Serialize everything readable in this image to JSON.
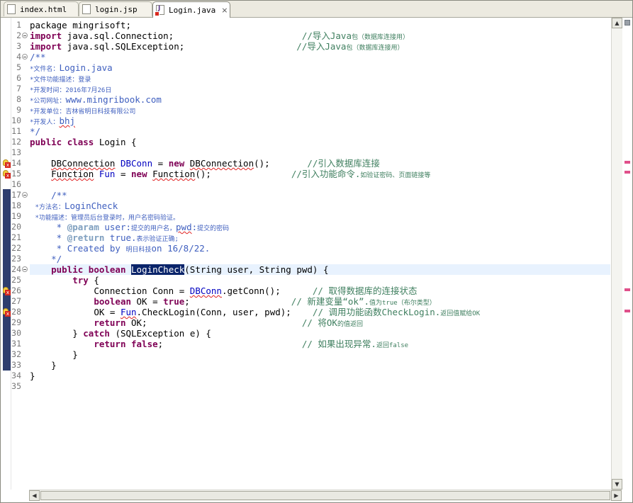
{
  "tabs": [
    {
      "label": "index.html",
      "active": false
    },
    {
      "label": "login.jsp",
      "active": false
    },
    {
      "label": "Login.java",
      "active": true,
      "close": "⨯"
    }
  ],
  "scroll": {
    "up": "▲",
    "down": "▼",
    "left": "◀",
    "right": "▶"
  },
  "code": {
    "line_numbers": [
      "1",
      "2",
      "3",
      "4",
      "5",
      "6",
      "7",
      "8",
      "9",
      "10",
      "11",
      "12",
      "13",
      "14",
      "15",
      "16",
      "17",
      "18",
      "19",
      "20",
      "21",
      "22",
      "23",
      "24",
      "25",
      "26",
      "27",
      "28",
      "29",
      "30",
      "31",
      "32",
      "33",
      "34",
      "35"
    ],
    "l1": "package mingrisoft;",
    "l2": {
      "kw": "import",
      "text": " java.sql.Connection;",
      "pad": "                        ",
      "cm": "//导入Java",
      "cm_sm": "包（数据库连接用）"
    },
    "l3": {
      "kw": "import",
      "text": " java.sql.SQLException;",
      "pad": "                     ",
      "cm": "//导入Java",
      "cm_sm": "包（数据库连接用）"
    },
    "l4": "/**",
    "l5": {
      "star": "*",
      "label": "文件名：",
      "value": "Login.java"
    },
    "l6": {
      "star": "*",
      "label": "文件功能描述：登录"
    },
    "l7": {
      "star": "*",
      "label": "开发时间：2016年7月26日"
    },
    "l8": {
      "star": "*",
      "label": "公司网址：",
      "value": "www.mingribook.com"
    },
    "l9": {
      "star": "*",
      "label": "开发单位：吉林省明日科技有限公司"
    },
    "l10": {
      "star": "*",
      "label": "开发人：",
      "value": "bhj"
    },
    "l11": "*/",
    "l12": {
      "kw1": "public",
      "kw2": "class",
      "text": " Login {"
    },
    "l14": {
      "type": "DBConnection",
      "field": "DBConn",
      "eq": " = ",
      "kw": "new",
      "ctor": "DBConnection",
      "tail": "();",
      "pad": "       ",
      "cm": "//引入数据库连接"
    },
    "l15": {
      "type": "Function",
      "field": "Fun",
      "eq": " = ",
      "kw": "new",
      "ctor": "Function",
      "tail": "();",
      "pad": "               ",
      "cm": "//引入功能命令.",
      "cm_sm": "如验证密码、页面链接等"
    },
    "l17": "/**",
    "l18": {
      "star": "*",
      "label": "方法名：",
      "value": "LoginCheck"
    },
    "l19": {
      "star": "*",
      "label": "功能描述：管理员后台登录时，用户名密码验证。"
    },
    "l20": {
      "star": "* ",
      "tag": "@param",
      "a": " user:",
      "a_sm": "提交的用户名，",
      "b": "pwd",
      "c": ":",
      "c_sm": "提交的密码"
    },
    "l21": {
      "star": "* ",
      "tag": "@return",
      "a": " true.",
      "a_sm": "表示验证正确;"
    },
    "l22": {
      "star": "* ",
      "a": "Created by ",
      "a_sm": "明日科技",
      "b": "on 16/8/22."
    },
    "l23": "*/",
    "l24": {
      "kw1": "public",
      "kw2": "boolean",
      "method": "LoginCheck",
      "p1": "(String ",
      "a1": "user",
      "p2": ", String ",
      "a2": "pwd",
      "p3": ") {"
    },
    "l25": "try",
    "l25_tail": " {",
    "l26": {
      "type": "Connection ",
      "var": "Conn",
      "eq": " = ",
      "obj": "DBConn",
      "tail": ".getConn();",
      "pad": "      ",
      "cm": "// 取得数据库的连接状态"
    },
    "l27": {
      "kw": "boolean",
      "var": " OK",
      "eq": " = ",
      "kw2": "true",
      "tail": ";",
      "pad": "                   ",
      "cm": "// 新建变量“ok”.",
      "cm_sm": "值为true（布尔类型）"
    },
    "l28": {
      "a": "OK",
      "b": " = ",
      "obj": "Fun",
      "c": ".CheckLogin(Conn, ",
      "d": "user",
      "e": ", ",
      "f": "pwd",
      "g": ");",
      "pad": "    ",
      "cm": "// 调用功能函数CheckLogin.",
      "cm_sm": "返回值赋给OK"
    },
    "l29": {
      "kw": "return",
      "var": " OK",
      "tail": ";",
      "pad": "                             ",
      "cm": "// 将OK",
      "cm_sm": "的值返回"
    },
    "l30": {
      "a": "} ",
      "kw": "catch",
      "b": " (SQLException ",
      "var": "e",
      "c": ") {"
    },
    "l31": {
      "kw": "return",
      "kw2": " false",
      "tail": ";",
      "pad": "                          ",
      "cm": "// 如果出现异常.",
      "cm_sm": "返回false"
    },
    "l32": "}",
    "l33": "}",
    "l34": "}"
  }
}
